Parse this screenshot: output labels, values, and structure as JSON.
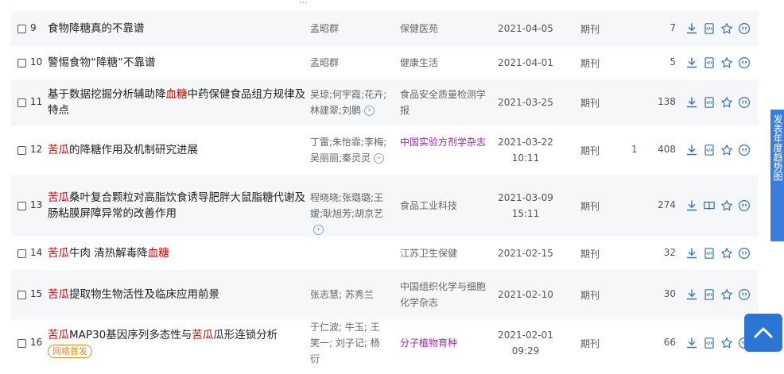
{
  "top_fragment": "…",
  "rows": [
    {
      "index": "9",
      "title_parts": [
        {
          "t": "食物降糖真的不靠谱",
          "hl": false
        }
      ],
      "authors": "孟昭群",
      "source": "保健医苑",
      "source_purple": false,
      "date": "2021-04-05",
      "date2": "",
      "type": "期刊",
      "cited": "",
      "downloads": "7",
      "read_icon": "html"
    },
    {
      "index": "10",
      "title_parts": [
        {
          "t": "警惕食物“降糖”不靠谱",
          "hl": false
        }
      ],
      "authors": "孟昭群",
      "source": "健康生活",
      "source_purple": false,
      "date": "2021-04-01",
      "date2": "",
      "type": "期刊",
      "cited": "",
      "downloads": "5",
      "read_icon": "html"
    },
    {
      "index": "11",
      "title_parts": [
        {
          "t": "基于数据挖掘分析辅助降",
          "hl": false
        },
        {
          "t": "血糖",
          "hl": true
        },
        {
          "t": "中药保健食品组方规律及特点",
          "hl": false
        }
      ],
      "authors": "吴琼;何宇霞;花卉;林建翠;刘鹏",
      "authors_more": true,
      "source": "食品安全质量检测学报",
      "source_purple": false,
      "date": "2021-03-25",
      "date2": "",
      "type": "期刊",
      "cited": "",
      "downloads": "138",
      "read_icon": "html"
    },
    {
      "index": "12",
      "title_parts": [
        {
          "t": "苦瓜",
          "hl": true
        },
        {
          "t": "的降糖作用及机制研究进展",
          "hl": false
        }
      ],
      "authors": "丁雷;朱怡霏;李梅;吴丽丽;秦灵灵",
      "authors_more": true,
      "source": "中国实验方剂学杂志",
      "source_purple": true,
      "date": "2021-03-22",
      "date2": "10:11",
      "type": "期刊",
      "cited": "1",
      "downloads": "408",
      "read_icon": "html"
    },
    {
      "index": "13",
      "title_parts": [
        {
          "t": "苦瓜",
          "hl": true
        },
        {
          "t": "桑叶复合颗粒对高脂饮食诱导肥胖大鼠脂糖代谢及肠粘膜屏障异常的改善作用",
          "hl": false
        }
      ],
      "authors": "程晓晓;张璐璐;王嫒;耿旭芳;胡京艺",
      "authors_more": true,
      "source": "食品工业科技",
      "source_purple": false,
      "date": "2021-03-09",
      "date2": "15:11",
      "type": "期刊",
      "cited": "",
      "downloads": "274",
      "read_icon": "book"
    },
    {
      "index": "14",
      "title_parts": [
        {
          "t": "苦瓜",
          "hl": true
        },
        {
          "t": "牛肉 清热解毒降",
          "hl": false
        },
        {
          "t": "血糖",
          "hl": true
        }
      ],
      "authors": "",
      "source": "江苏卫生保健",
      "source_purple": false,
      "date": "2021-02-15",
      "date2": "",
      "type": "期刊",
      "cited": "",
      "downloads": "32",
      "read_icon": "html"
    },
    {
      "index": "15",
      "title_parts": [
        {
          "t": "苦瓜",
          "hl": true
        },
        {
          "t": "提取物生物活性及临床应用前景",
          "hl": false
        }
      ],
      "authors": "张志慧; 苏秀兰",
      "source": "中国组织化学与细胞化学杂志",
      "source_purple": false,
      "date": "2021-02-10",
      "date2": "",
      "type": "期刊",
      "cited": "",
      "downloads": "30",
      "read_icon": "html"
    },
    {
      "index": "16",
      "title_parts": [
        {
          "t": "苦瓜",
          "hl": true
        },
        {
          "t": "MAP30基因序列多态性与",
          "hl": false
        },
        {
          "t": "苦瓜",
          "hl": true
        },
        {
          "t": "瓜形连锁分析",
          "hl": false
        }
      ],
      "badge": "网络首发",
      "authors": "于仁波; 牛玉; 王笑一; 刘子记; 杨衍",
      "source": "分子植物育种",
      "source_purple": true,
      "date": "2021-02-01",
      "date2": "09:29",
      "type": "期刊",
      "cited": "",
      "downloads": "66",
      "read_icon": "html"
    }
  ],
  "float_tab": {
    "label": "发表年度趋势图"
  },
  "colors": {
    "accent": "#2a76d2",
    "highlight": "#cc0000",
    "purple": "#9b25b8",
    "badge": "#e58a2a"
  }
}
